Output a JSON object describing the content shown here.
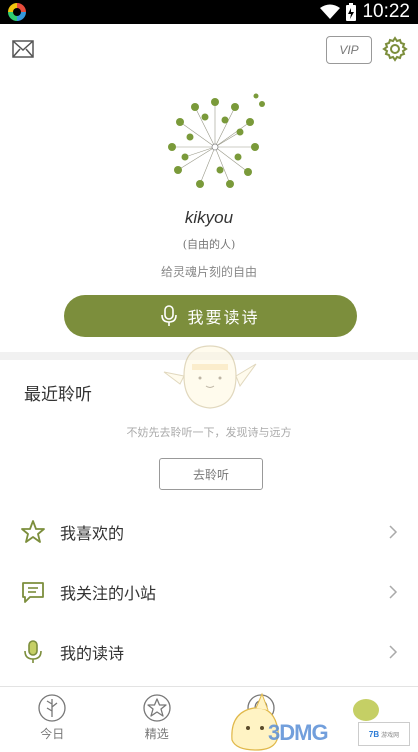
{
  "status_bar": {
    "time": "10:22"
  },
  "top_bar": {
    "vip_label": "VIP",
    "icons": [
      "mail-icon",
      "gear-icon"
    ]
  },
  "profile": {
    "username": "kikyou",
    "tagline": "(自由的人)",
    "bio": "给灵魂片刻的自由"
  },
  "recite_button": {
    "label": "我要读诗",
    "icon": "microphone-icon"
  },
  "recent_listening": {
    "title": "最近聆听",
    "empty_text": "不妨先去聆听一下，发现诗与远方",
    "button_label": "去聆听"
  },
  "menu": [
    {
      "label": "我喜欢的",
      "icon": "star-icon"
    },
    {
      "label": "我关注的小站",
      "icon": "chat-bubble-icon"
    },
    {
      "label": "我的读诗",
      "icon": "microphone-icon"
    }
  ],
  "tab_bar": {
    "tabs": [
      {
        "label": "今日",
        "icon": "tree-icon"
      },
      {
        "label": "精选",
        "icon": "star-badge-icon"
      },
      {
        "label": "",
        "icon": "mascot-icon"
      },
      {
        "label": "",
        "icon": "profile-blob-icon"
      }
    ]
  },
  "watermark": {
    "text": "3DMG",
    "badge_num": "7B",
    "badge_text": "游戏网"
  },
  "colors": {
    "accent": "#7c8e3c",
    "leaf_green": "#7a9a3a",
    "text": "#333333"
  }
}
